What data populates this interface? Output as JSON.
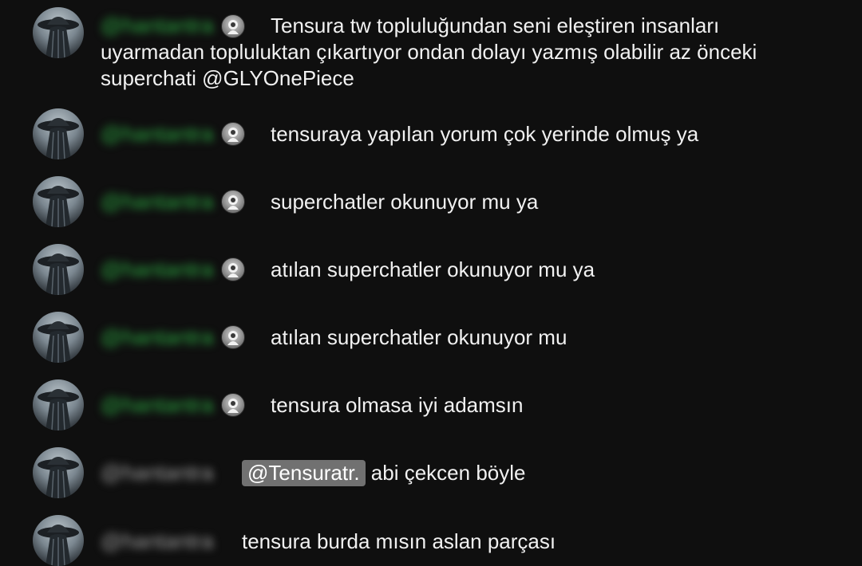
{
  "messages": [
    {
      "author": "@hantantra",
      "has_badge": true,
      "text_line1": "Tensura tw topluluğundan seni eleştiren insanları",
      "text_rest": "uyarmadan topluluktan çıkartıyor ondan dolayı yazmış olabilir az önceki superchati @GLYOnePiece"
    },
    {
      "author": "@hantantra",
      "has_badge": true,
      "text": "tensuraya yapılan yorum çok yerinde olmuş ya"
    },
    {
      "author": "@hantantra",
      "has_badge": true,
      "text": "superchatler okunuyor mu ya"
    },
    {
      "author": "@hantantra",
      "has_badge": true,
      "text": "atılan superchatler okunuyor mu ya"
    },
    {
      "author": "@hantantra",
      "has_badge": true,
      "text": "atılan superchatler okunuyor mu"
    },
    {
      "author": "@hantantra",
      "has_badge": true,
      "text": "tensura olmasa iyi adamsın"
    },
    {
      "author": "@hantantra",
      "has_badge": false,
      "mention": "@Tensuratr.",
      "text": "abi çekcen böyle"
    },
    {
      "author": "@hantantra",
      "has_badge": false,
      "text": "tensura burda mısın aslan parçası"
    }
  ],
  "colors": {
    "background": "#0f0f0f",
    "member_name": "#2ba640",
    "plain_name": "#9a9a9a",
    "message_text": "#f1f1f1",
    "mention_bg": "#717171"
  },
  "icons": {
    "avatar": "user-avatar-icon",
    "badge": "member-badge-icon"
  }
}
